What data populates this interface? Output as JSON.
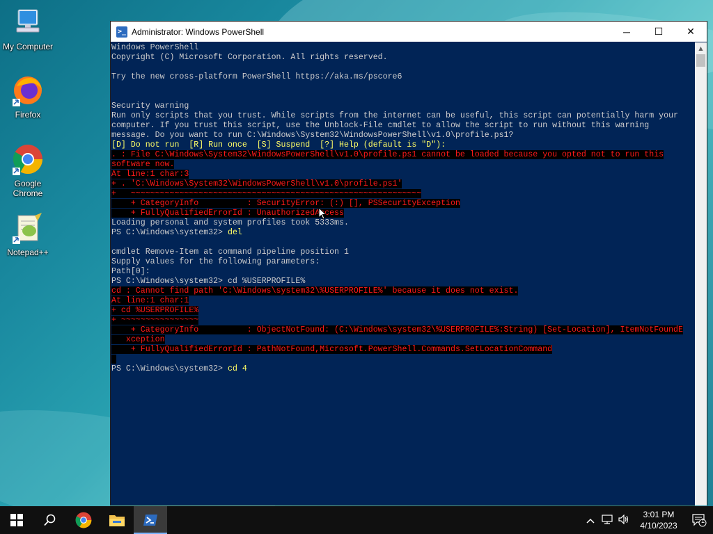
{
  "desktop": {
    "icons": [
      {
        "label": "My Computer",
        "icon": "computer-icon"
      },
      {
        "label": "Firefox",
        "icon": "firefox-icon"
      },
      {
        "label": "Google Chrome",
        "icon": "chrome-icon"
      },
      {
        "label": "Notepad++",
        "icon": "notepad-plus-plus-icon"
      }
    ]
  },
  "window": {
    "title": "Administrator: Windows PowerShell",
    "minimize": "─",
    "maximize": "☐",
    "close": "✕"
  },
  "console": {
    "lines": [
      {
        "t": "Windows PowerShell",
        "c": ""
      },
      {
        "t": "Copyright (C) Microsoft Corporation. All rights reserved.",
        "c": ""
      },
      {
        "t": "",
        "c": ""
      },
      {
        "t": "Try the new cross-platform PowerShell https://aka.ms/pscore6",
        "c": ""
      },
      {
        "t": "",
        "c": ""
      },
      {
        "t": "",
        "c": ""
      },
      {
        "t": "Security warning",
        "c": ""
      },
      {
        "t": "Run only scripts that you trust. While scripts from the internet can be useful, this script can potentially harm your",
        "c": ""
      },
      {
        "t": "computer. If you trust this script, use the Unblock-File cmdlet to allow the script to run without this warning",
        "c": ""
      },
      {
        "t": "message. Do you want to run C:\\Windows\\System32\\WindowsPowerShell\\v1.0\\profile.ps1?",
        "c": ""
      },
      {
        "t": "[D] Do not run  [R] Run once  [S] Suspend  [?] Help (default is \"D\"):",
        "c": "warn"
      },
      {
        "t": ". : File C:\\Windows\\System32\\WindowsPowerShell\\v1.0\\profile.ps1 cannot be loaded because you opted not to run this",
        "c": "err"
      },
      {
        "t": "software now.",
        "c": "err"
      },
      {
        "t": "At line:1 char:3",
        "c": "err"
      },
      {
        "t": "+ . 'C:\\Windows\\System32\\WindowsPowerShell\\v1.0\\profile.ps1'",
        "c": "err"
      },
      {
        "t": "+   ~~~~~~~~~~~~~~~~~~~~~~~~~~~~~~~~~~~~~~~~~~~~~~~~~~~~~~~~~~~~",
        "c": "err"
      },
      {
        "t": "    + CategoryInfo          : SecurityError: (:) [], PSSecurityException",
        "c": "err"
      },
      {
        "t": "    + FullyQualifiedErrorId : UnauthorizedAccess",
        "c": "err"
      },
      {
        "t": "Loading personal and system profiles took 5333ms.",
        "c": ""
      },
      {
        "t": "PS C:\\Windows\\system32> del",
        "c": "",
        "cmd": "del"
      },
      {
        "t": "",
        "c": ""
      },
      {
        "t": "cmdlet Remove-Item at command pipeline position 1",
        "c": ""
      },
      {
        "t": "Supply values for the following parameters:",
        "c": ""
      },
      {
        "t": "Path[0]:",
        "c": ""
      },
      {
        "t": "PS C:\\Windows\\system32> cd %USERPROFILE%",
        "c": ""
      },
      {
        "t": "cd : Cannot find path 'C:\\Windows\\system32\\%USERPROFILE%' because it does not exist.",
        "c": "err"
      },
      {
        "t": "At line:1 char:1",
        "c": "err"
      },
      {
        "t": "+ cd %USERPROFILE%",
        "c": "err"
      },
      {
        "t": "+ ~~~~~~~~~~~~~~~~",
        "c": "err"
      },
      {
        "t": "    + CategoryInfo          : ObjectNotFound: (C:\\Windows\\system32\\%USERPROFILE%:String) [Set-Location], ItemNotFoundE",
        "c": "err"
      },
      {
        "t": "   xception",
        "c": "err"
      },
      {
        "t": "    + FullyQualifiedErrorId : PathNotFound,Microsoft.PowerShell.Commands.SetLocationCommand",
        "c": "err"
      },
      {
        "t": " ",
        "c": "err"
      },
      {
        "t": "PS C:\\Windows\\system32> cd 4",
        "c": "",
        "cmd": "cd 4"
      }
    ]
  },
  "taskbar": {
    "items": [
      {
        "name": "start-button",
        "icon": "windows-logo-icon"
      },
      {
        "name": "search-button",
        "icon": "search-icon"
      },
      {
        "name": "chrome-taskbar-button",
        "icon": "chrome-icon"
      },
      {
        "name": "file-explorer-button",
        "icon": "folder-icon"
      },
      {
        "name": "powershell-taskbar-button",
        "icon": "powershell-icon",
        "active": true
      }
    ],
    "time": "3:01 PM",
    "date": "4/10/2023",
    "notification_count": "1"
  },
  "colors": {
    "console_bg": "#012456",
    "console_fg": "#cccccc",
    "error_fg": "#ff1a1a",
    "prompt_fg": "#ffff66",
    "taskbar_bg": "#101010"
  }
}
